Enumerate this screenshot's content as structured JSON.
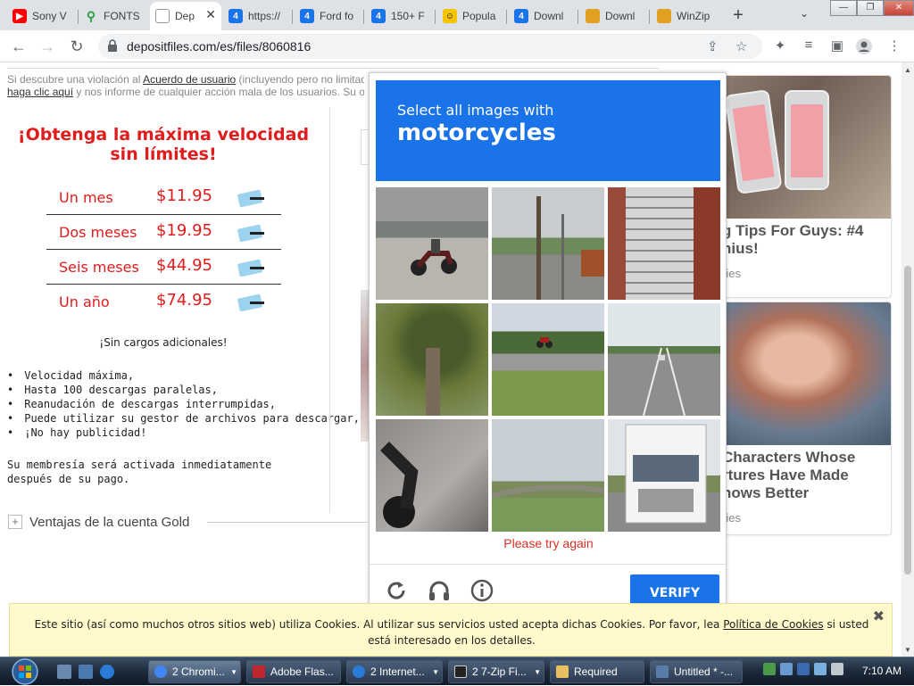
{
  "browser": {
    "tabs": [
      {
        "label": "Sony V",
        "favicon_color": "#ff0000"
      },
      {
        "label": "FONTS",
        "favicon_color": "#2a9d3a"
      },
      {
        "label": "Dep",
        "favicon_color": "#ffffff",
        "active": true
      },
      {
        "label": "https://",
        "favicon_color": "#1a73e8"
      },
      {
        "label": "Ford fo",
        "favicon_color": "#1a73e8"
      },
      {
        "label": "150+ F",
        "favicon_color": "#1a73e8"
      },
      {
        "label": "Popula",
        "favicon_color": "#f5c400"
      },
      {
        "label": "Downl",
        "favicon_color": "#1a73e8"
      },
      {
        "label": "Downl",
        "favicon_color": "#e0a020"
      },
      {
        "label": "WinZip",
        "favicon_color": "#e0a020"
      }
    ],
    "url": "depositfiles.com/es/files/8060816"
  },
  "page": {
    "topnote_prefix": "Si descubre una violación al ",
    "topnote_link": "Acuerdo de usuario",
    "topnote_suffix": " (incluyendo pero no limitado",
    "topnote2_link": "haga clic aquí",
    "topnote2_suffix": " y nos informe de cualquier acción mala de los usuarios. Su op",
    "offer_title": "¡Obtenga la máxima velocidad sin límites!",
    "plans": [
      {
        "label": "Un mes",
        "price": "$11.95"
      },
      {
        "label": "Dos meses",
        "price": "$19.95"
      },
      {
        "label": "Seis meses",
        "price": "$44.95"
      },
      {
        "label": "Un año",
        "price": "$74.95"
      }
    ],
    "no_charges": "¡Sin cargos adicionales!",
    "features": [
      "Velocidad máxima,",
      "Hasta 100 descargas paralelas,",
      "Reanudación de descargas interrumpidas,",
      "Puede utilizar su gestor de archivos para descargar,",
      "¡No hay publicidad!"
    ],
    "membership_note": "Su membresía será activada inmediatamente después de su pago.",
    "gold_label": "Ventajas de la cuenta Gold"
  },
  "ads": [
    {
      "title": "g Tips For Guys: #4\nnius!",
      "source": "ries"
    },
    {
      "title": "Characters Whose\nrtures Have Made\nhows Better",
      "source": "ries"
    }
  ],
  "captcha": {
    "instruction": "Select all images with",
    "target": "motorcycles",
    "error": "Please try again",
    "verify_label": "VERIFY"
  },
  "cookie": {
    "text_prefix": "Este sitio (así como muchos otros sitios web) utiliza Cookies. Al utilizar sus servicios usted acepta dichas Cookies. Por favor, lea ",
    "link": "Política de Cookies",
    "text_suffix": " si usted está interesado en los detalles."
  },
  "taskbar": {
    "buttons": [
      {
        "label": "2 Chromi...",
        "color": "#4285f4"
      },
      {
        "label": "Adobe Flas...",
        "color": "#c0262d"
      },
      {
        "label": "2 Internet...",
        "color": "#2a7bd8"
      },
      {
        "label": "2 7-Zip Fi...",
        "color": "#222222"
      },
      {
        "label": "Required",
        "color": "#e8c060"
      },
      {
        "label": "Untitled * -...",
        "color": "#5a7ca8"
      }
    ],
    "clock": "7:10 AM"
  }
}
